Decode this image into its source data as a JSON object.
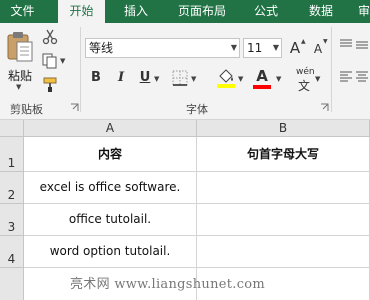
{
  "ribbon": {
    "tabs": [
      {
        "label": "文件",
        "active": false
      },
      {
        "label": "开始",
        "active": true
      },
      {
        "label": "插入",
        "active": false
      },
      {
        "label": "页面布局",
        "active": false
      },
      {
        "label": "公式",
        "active": false
      },
      {
        "label": "数据",
        "active": false
      },
      {
        "label": "审",
        "active": false
      }
    ],
    "clipboard": {
      "paste_label": "粘贴",
      "group_label": "剪贴板"
    },
    "font": {
      "font_name": "等线",
      "font_size": "11",
      "group_label": "字体",
      "increase_label": "A",
      "decrease_label": "A",
      "bold_label": "B",
      "italic_label": "I",
      "underline_label": "U",
      "font_color_label": "A",
      "wen_top": "wén",
      "wen_bottom": "文",
      "fill_color": "#ffff00",
      "font_color": "#ff0000"
    }
  },
  "sheet": {
    "columns": [
      "A",
      "B"
    ],
    "rows": [
      "1",
      "2",
      "3",
      "4"
    ],
    "cells": [
      [
        "内容",
        "句首字母大写"
      ],
      [
        "excel is office software.",
        ""
      ],
      [
        "office tutolail.",
        ""
      ],
      [
        "word option tutolail.",
        ""
      ]
    ]
  },
  "watermark": "亮术网 www.liangshunet.com"
}
